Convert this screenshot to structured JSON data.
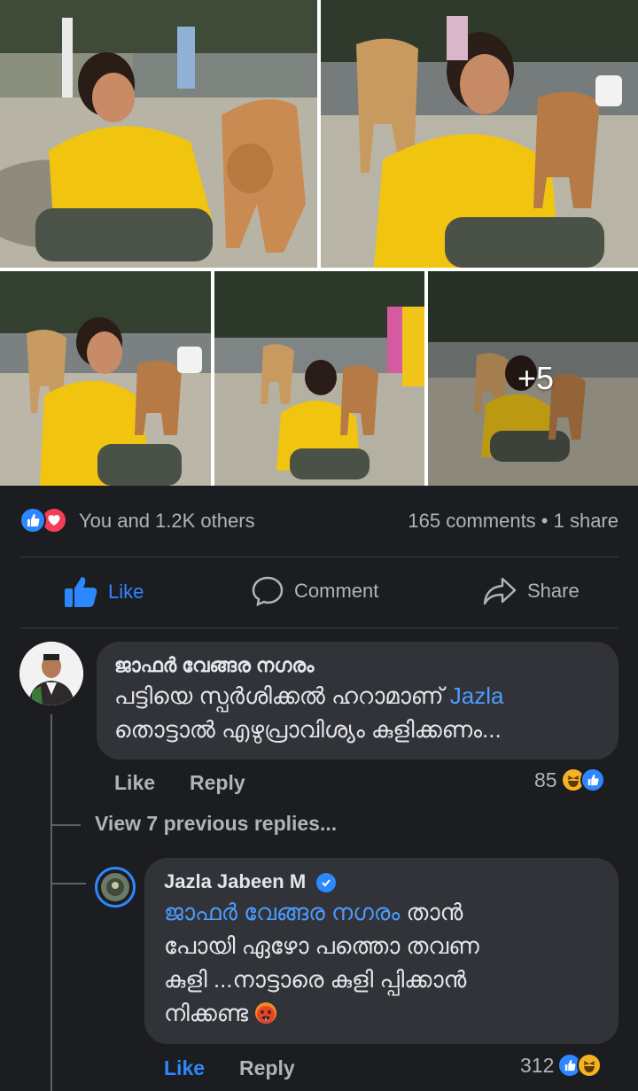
{
  "photos": {
    "more_count": "+5"
  },
  "reactions_summary": {
    "reaction_icons": [
      "like-icon",
      "love-icon"
    ],
    "people_text": "You and 1.2K others",
    "stats_text": "165 comments • 1 share",
    "like_color": "#2d88ff",
    "love_color": "#f33e58"
  },
  "action_bar": {
    "like_label": "Like",
    "comment_label": "Comment",
    "share_label": "Share"
  },
  "comments": [
    {
      "author": "ജാഫർ വേങ്ങര നഗരം",
      "body_line1_text": "പട്ടിയെ സ്പർശിക്കൽ ഹറാമാണ്",
      "body_line1_mention": "Jazla",
      "body_line2": "തൊട്ടാൽ എഴുപ്രാവിശ്യം കുളിക്കണം...",
      "like_label": "Like",
      "reply_label": "Reply",
      "reaction_count": "85",
      "reaction_icons": [
        "haha-icon",
        "like-icon"
      ]
    }
  ],
  "view_replies_label": "View 7 previous replies...",
  "reply": {
    "author": "Jazla Jabeen M",
    "verified": true,
    "mention": "ജാഫർ വേങ്ങര നഗരം",
    "line1_rest": "താൻ",
    "line2": "പോയി ഏഴോ പത്തൊ തവണ",
    "line3": "കുളി ...നാട്ടാരെ കുളി പ്പിക്കാൻ",
    "line4": "നിക്കണ്ട",
    "emoji": "hot-face-emoji",
    "like_label": "Like",
    "reply_label": "Reply",
    "reaction_count": "312",
    "reaction_icons": [
      "like-icon",
      "haha-icon"
    ]
  }
}
